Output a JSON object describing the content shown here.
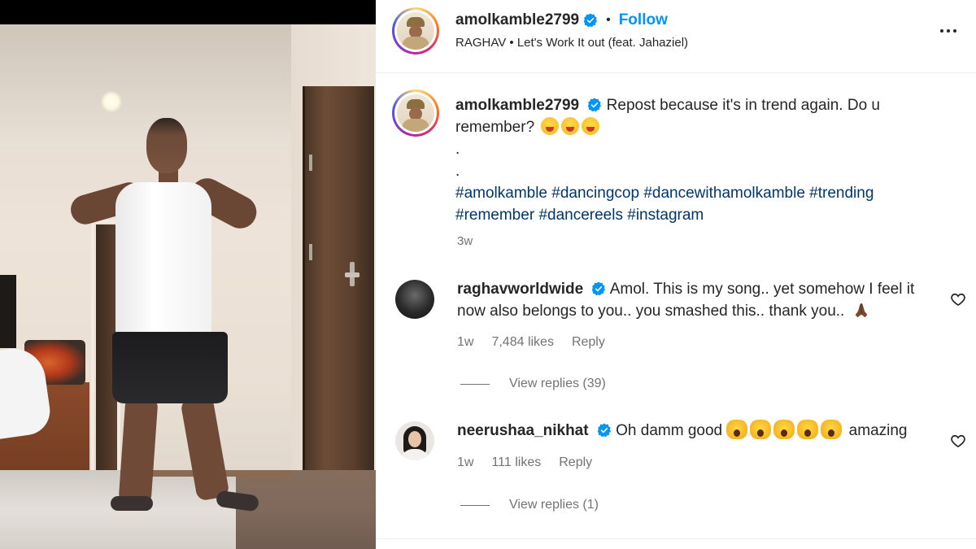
{
  "post": {
    "username": "amolkamble2799",
    "follow_label": "Follow",
    "separator": "•",
    "audio_artist": "RAGHAV",
    "audio_title": "Let's Work It out (feat. Jahaziel)",
    "caption_text": "Repost because it's in trend again. Do u remember?",
    "caption_emoji": "smiling-face-with-tongue x3",
    "caption_dots": [
      ".",
      "."
    ],
    "hashtags": [
      "#amolkamble",
      "#dancingcop",
      "#dancewithamolkamble",
      "#trending",
      "#remember",
      "#dancereels",
      "#instagram"
    ],
    "timestamp": "3w"
  },
  "comments": [
    {
      "username": "raghavworldwide",
      "text": "Amol. This is my song.. yet somehow I feel it now also belongs to you.. you smashed this.. thank you..",
      "emoji": "folded-hands",
      "time": "1w",
      "likes": "7,484 likes",
      "reply_label": "Reply",
      "view_replies": "View replies (39)"
    },
    {
      "username": "neerushaa_nikhat",
      "text_before": "Oh damm good",
      "emoji": "face-screaming-in-fear x5",
      "text_after": "amazing",
      "time": "1w",
      "likes": "111 likes",
      "reply_label": "Reply",
      "view_replies": "View replies (1)"
    }
  ],
  "icons": {
    "verified": "verified-badge-icon",
    "more": "more-options-icon",
    "heart": "heart-icon"
  },
  "colors": {
    "follow": "#0095f6",
    "verified": "#0095f6",
    "hashtag": "#00376b",
    "muted": "#737373"
  }
}
